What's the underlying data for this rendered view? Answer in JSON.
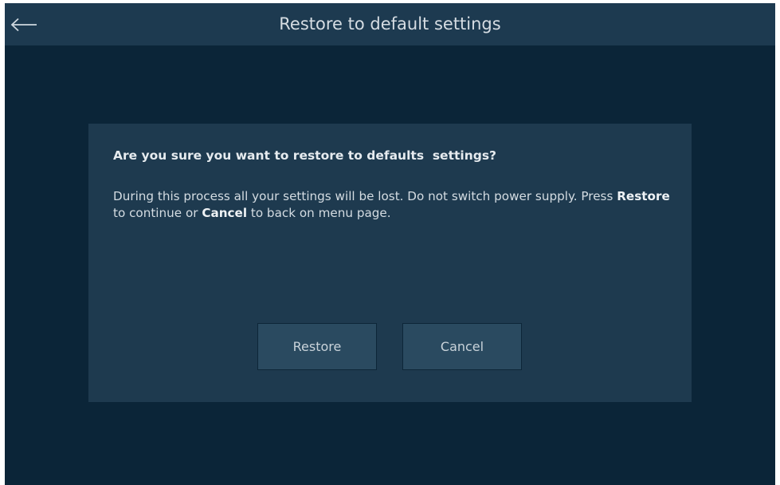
{
  "header": {
    "title": "Restore to default settings",
    "back_icon": "arrow-left-icon"
  },
  "dialog": {
    "question": "Are you sure you want to restore to defaults  settings?",
    "message": {
      "part1": "During this process all your settings will be lost. Do not switch power supply. Press ",
      "restore_word": "Restore",
      "part2": " to continue or ",
      "cancel_word": "Cancel",
      "part3": " to back on menu page."
    },
    "restore_label": "Restore",
    "cancel_label": "Cancel"
  },
  "colors": {
    "background": "#0b2538",
    "header": "#1d3a50",
    "dialog": "#1e3a4f",
    "button": "#2a4a60",
    "text": "#d4dce2"
  }
}
